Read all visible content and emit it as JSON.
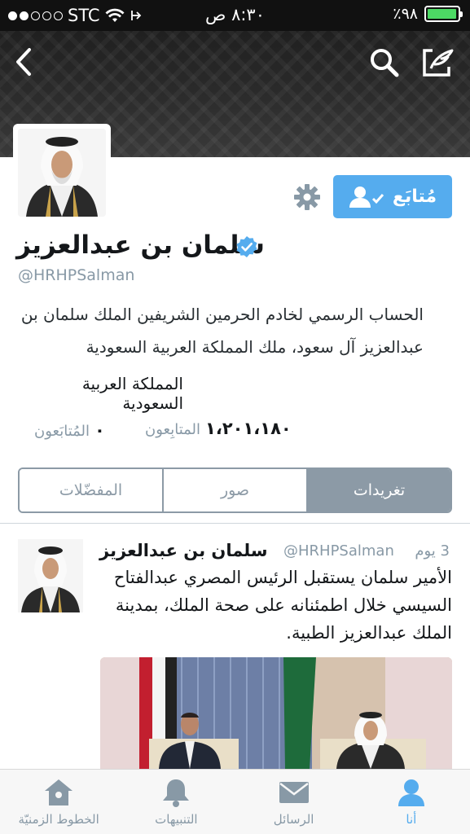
{
  "status_bar": {
    "carrier": "STC",
    "time": "٨:٣٠ ص",
    "battery": "٪٩٨",
    "battery_level": 0.98
  },
  "header": {
    "back_icon": "chevron-left-icon",
    "search_icon": "search-icon",
    "compose_icon": "compose-icon"
  },
  "profile": {
    "follow_label": "مُتابَع",
    "display_name": "سلمان بن عبدالعزيز",
    "handle": "@HRHPSalman",
    "bio": "الحساب الرسمي لخادم الحرمين الشريفين الملك سلمان بن عبدالعزيز آل سعود، ملك المملكة العربية السعودية",
    "location": "المملكة العربية السعودية",
    "followers_count": "١،٢٠١،١٨٠",
    "followers_label": "المتابِعون",
    "following_count": "٠",
    "following_label": "المُتابَعون"
  },
  "segments": [
    {
      "label": "المفضّلات"
    },
    {
      "label": "صور"
    },
    {
      "label": "تغريدات"
    }
  ],
  "tweet": {
    "name": "سلمان بن عبدالعزيز",
    "handle": "@HRHPSalman",
    "time": "3 يوم",
    "text": "الأمير سلمان يستقبل الرئيس المصري عبدالفتاح السيسي خلال اطمئنانه على صحة الملك، بمدينة الملك عبدالعزيز الطبية."
  },
  "tabbar": [
    {
      "label": "أنا",
      "icon": "person-icon"
    },
    {
      "label": "الرسائل",
      "icon": "envelope-icon"
    },
    {
      "label": "التنبيهات",
      "icon": "bell-icon"
    },
    {
      "label": "الخطوط الزمنيّة",
      "icon": "home-icon"
    }
  ],
  "colors": {
    "accent": "#55acee",
    "segment": "#8c9aa6",
    "battery": "#4cd964"
  }
}
